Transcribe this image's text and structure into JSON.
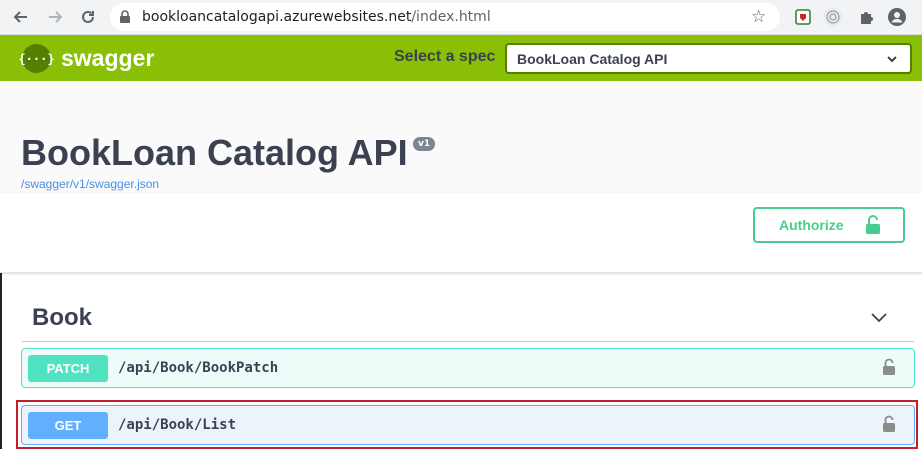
{
  "browser": {
    "url_host": "bookloancatalogapi.azurewebsites.net",
    "url_path": "/index.html"
  },
  "topbar": {
    "logo_symbol": "{···}",
    "logo_text": "swagger",
    "spec_label": "Select a spec",
    "spec_selected": "BookLoan Catalog API"
  },
  "info": {
    "title": "BookLoan Catalog API",
    "version": "v1",
    "spec_link": "/swagger/v1/swagger.json"
  },
  "scheme": {
    "authorize_label": "Authorize"
  },
  "tag": {
    "name": "Book"
  },
  "operations": [
    {
      "method": "PATCH",
      "path": "/api/Book/BookPatch"
    },
    {
      "method": "GET",
      "path": "/api/Book/List"
    }
  ],
  "colors": {
    "topbar": "#89bf04",
    "patch": "#50e3c2",
    "get": "#61affe",
    "authorize": "#49cc90",
    "highlight": "#c0202e"
  }
}
